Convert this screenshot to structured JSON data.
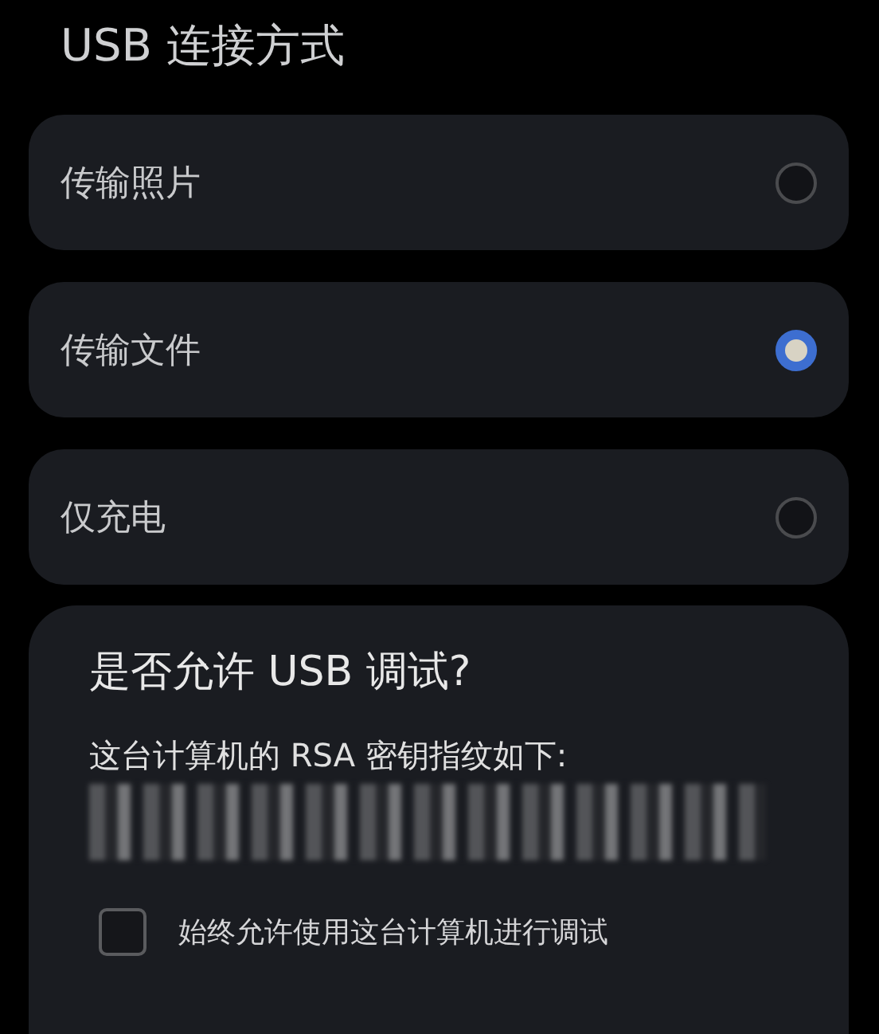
{
  "title": "USB 连接方式",
  "options": [
    {
      "label": "传输照片",
      "selected": false
    },
    {
      "label": "传输文件",
      "selected": true
    },
    {
      "label": "仅充电",
      "selected": false
    }
  ],
  "dialog": {
    "title": "是否允许 USB 调试?",
    "message": "这台计算机的 RSA 密钥指纹如下:",
    "checkbox": {
      "label": "始终允许使用这台计算机进行调试",
      "checked": false
    }
  }
}
